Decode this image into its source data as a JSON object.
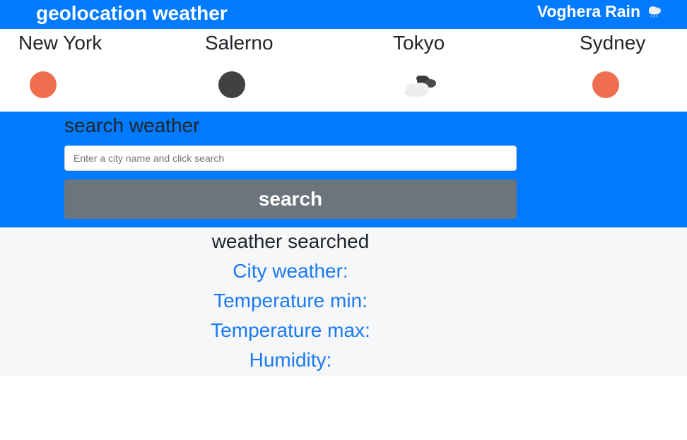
{
  "navbar": {
    "brand": "geolocation weather",
    "location_city": "Voghera",
    "location_condition": "Rain",
    "location_icon": "rain-cloud-icon"
  },
  "cities": [
    {
      "name": "New York",
      "icon": "sun-icon"
    },
    {
      "name": "Salerno",
      "icon": "dark-moon-icon"
    },
    {
      "name": "Tokyo",
      "icon": "broken-clouds-icon"
    },
    {
      "name": "Sydney",
      "icon": "sun-icon"
    }
  ],
  "search": {
    "title": "search weather",
    "placeholder": "Enter a city name and click search",
    "value": "",
    "button_label": "search"
  },
  "results": {
    "title": "weather searched",
    "city_weather_label": "City weather:",
    "temp_min_label": "Temperature min:",
    "temp_max_label": "Temperature max:",
    "humidity_label": "Humidity:"
  },
  "colors": {
    "primary": "#007bff",
    "secondary": "#6c757d",
    "sun": "#ee6e4f",
    "result_text": "#1a7af0",
    "results_bg": "#f6f7f8"
  }
}
